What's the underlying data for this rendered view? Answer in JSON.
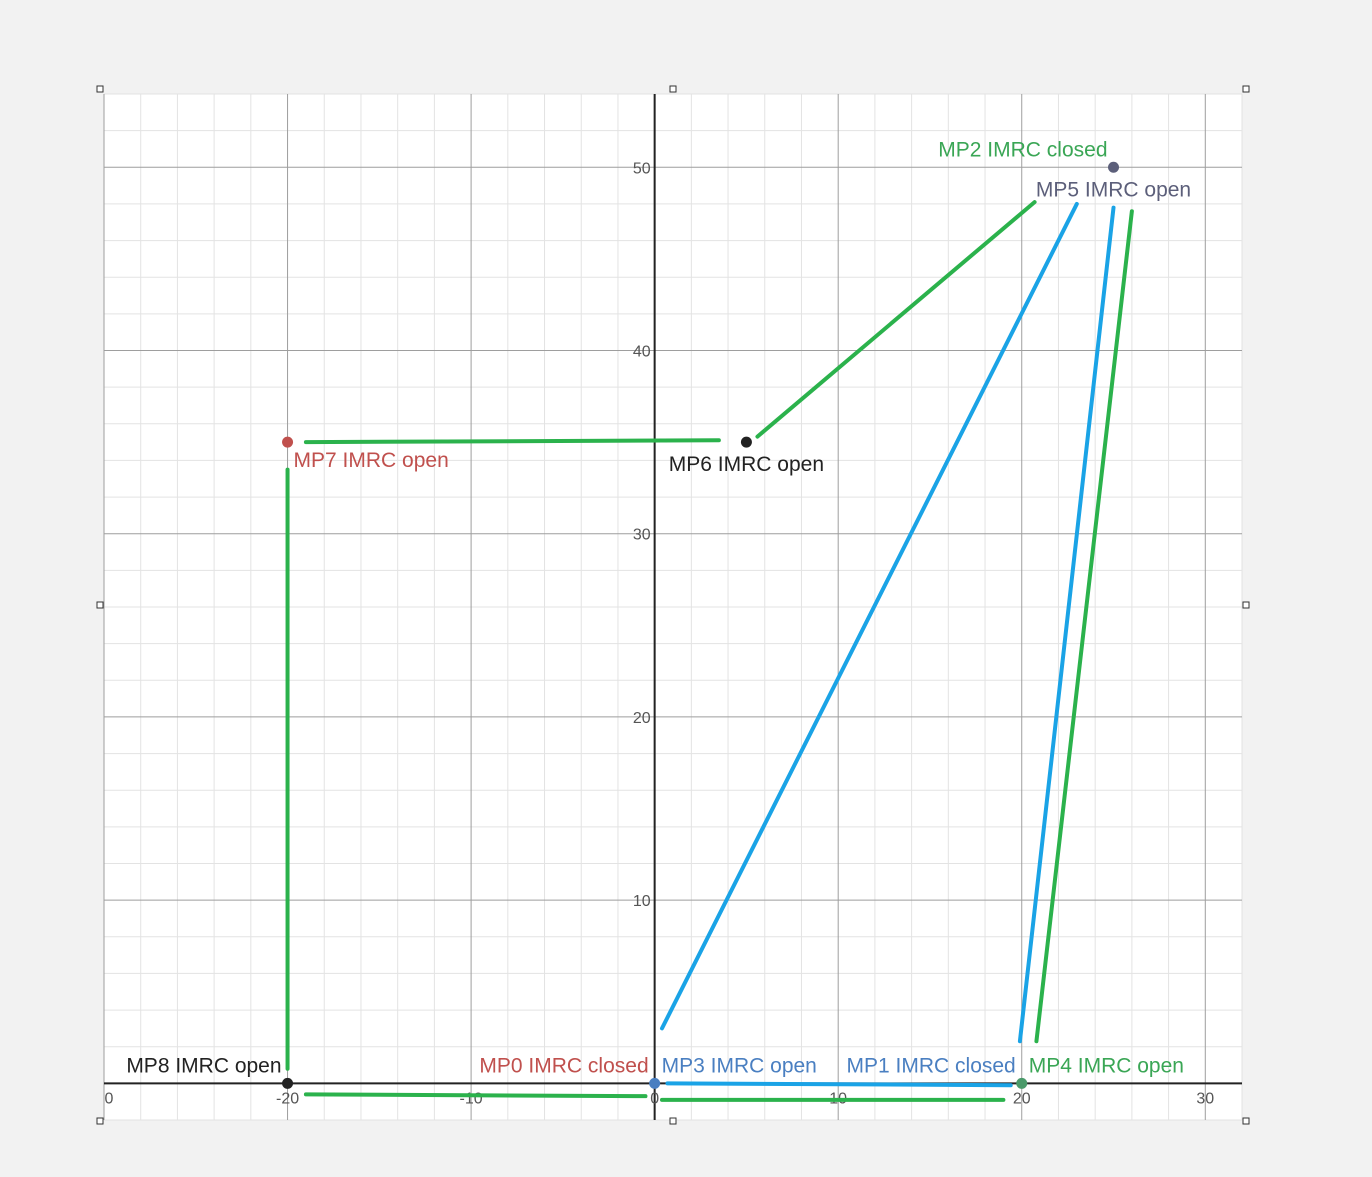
{
  "chart_data": {
    "type": "scatter",
    "title": "",
    "xlabel": "",
    "ylabel": "",
    "xlim": [
      -30,
      32
    ],
    "ylim": [
      -2,
      54
    ],
    "major_x_step": 10,
    "major_y_step": 10,
    "minor_step": 2,
    "grid": true,
    "x_tick_labels": [
      "0",
      "-20",
      "-10",
      "0",
      "10",
      "20",
      "30"
    ],
    "x_tick_values": [
      -30,
      -20,
      -10,
      0,
      10,
      20,
      30
    ],
    "y_tick_labels": [
      "10",
      "20",
      "30",
      "40",
      "50"
    ],
    "y_tick_values": [
      10,
      20,
      30,
      40,
      50
    ],
    "points": [
      {
        "label": "MP0 IMRC closed",
        "x": 0,
        "y": 0,
        "color": "#4a7fc1",
        "label_color": "#c0504d",
        "label_side": "left"
      },
      {
        "label": "MP3 IMRC open",
        "x": 0,
        "y": 0,
        "color": "#4a7fc1",
        "label_color": "#4a7fc1",
        "label_side": "right"
      },
      {
        "label": "MP1 IMRC closed",
        "x": 20,
        "y": 0,
        "color": "#4a9a6a",
        "label_color": "#4a7fc1",
        "label_side": "left"
      },
      {
        "label": "MP4 IMRC open",
        "x": 20,
        "y": 0,
        "color": "#4a9a6a",
        "label_color": "#3aa655",
        "label_side": "right"
      },
      {
        "label": "MP2 IMRC closed",
        "x": 25,
        "y": 50,
        "color": "#5c5f7a",
        "label_color": "#3aa655",
        "label_side": "above-left"
      },
      {
        "label": "MP5 IMRC open",
        "x": 25,
        "y": 50,
        "color": "#5c5f7a",
        "label_color": "#5c5f7a",
        "label_side": "below"
      },
      {
        "label": "MP6 IMRC open",
        "x": 5,
        "y": 35,
        "color": "#222222",
        "label_color": "#222222",
        "label_side": "below"
      },
      {
        "label": "MP7 IMRC open",
        "x": -20,
        "y": 35,
        "color": "#c0504d",
        "label_color": "#c0504d",
        "label_side": "below-right"
      },
      {
        "label": "MP8 IMRC open",
        "x": -20,
        "y": 0,
        "color": "#222222",
        "label_color": "#222222",
        "label_side": "above-left"
      }
    ],
    "path_lines": [
      {
        "color": "#2bb24c",
        "from": [
          -19,
          -0.6
        ],
        "to": [
          -0.5,
          -0.7
        ]
      },
      {
        "color": "#2bb24c",
        "from": [
          -20,
          0.8
        ],
        "to": [
          -20,
          33.5
        ]
      },
      {
        "color": "#2bb24c",
        "from": [
          -19,
          35
        ],
        "to": [
          3.5,
          35.1
        ]
      },
      {
        "color": "#2bb24c",
        "from": [
          5.6,
          35.3
        ],
        "to": [
          20.7,
          48.1
        ]
      },
      {
        "color": "#2bb24c",
        "from": [
          26.0,
          47.6
        ],
        "to": [
          20.8,
          2.3
        ]
      },
      {
        "color": "#2bb24c",
        "from": [
          0.4,
          -0.9
        ],
        "to": [
          19.0,
          -0.9
        ]
      },
      {
        "color": "#1aa3e6",
        "from": [
          0.4,
          3.0
        ],
        "to": [
          23.0,
          48.0
        ]
      },
      {
        "color": "#1aa3e6",
        "from": [
          25.0,
          47.8
        ],
        "to": [
          19.9,
          2.3
        ]
      },
      {
        "color": "#1aa3e6",
        "from": [
          0.7,
          0
        ],
        "to": [
          19.4,
          -0.1
        ]
      }
    ]
  }
}
